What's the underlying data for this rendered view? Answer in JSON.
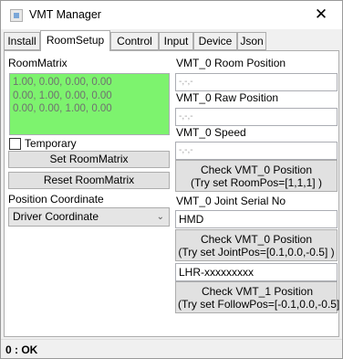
{
  "window": {
    "title": "VMT Manager",
    "close_glyph": "✕"
  },
  "tabs": [
    {
      "label": "Install"
    },
    {
      "label": "RoomSetup"
    },
    {
      "label": "Control"
    },
    {
      "label": "Input"
    },
    {
      "label": "Device"
    },
    {
      "label": "Json"
    }
  ],
  "room_matrix": {
    "label": "RoomMatrix",
    "rows": [
      "1.00, 0.00, 0.00, 0.00",
      "0.00, 1.00, 0.00, 0.00",
      "0.00, 0.00, 1.00, 0.00"
    ],
    "background": "#7df36e",
    "temporary_label": "Temporary",
    "temporary_checked": false,
    "set_button": "Set RoomMatrix",
    "reset_button": "Reset RoomMatrix"
  },
  "position_coordinate": {
    "label": "Position Coordinate",
    "selected": "Driver Coordinate"
  },
  "vmt0": {
    "room_position_label": "VMT_0 Room Position",
    "room_position_value": "-,-,-",
    "raw_position_label": "VMT_0 Raw Position",
    "raw_position_value": "-,-,-",
    "speed_label": "VMT_0 Speed",
    "speed_value": "-,-,-",
    "check_room_button": [
      "Check VMT_0 Position",
      "(Try set RoomPos=[1,1,1] )"
    ],
    "joint_serial_label": "VMT_0 Joint Serial No",
    "joint_serial_value": "HMD",
    "check_joint_button": [
      "Check VMT_0 Position",
      "(Try set JointPos=[0.1,0.0,-0.5] )"
    ]
  },
  "vmt1": {
    "follow_serial_value": "LHR-xxxxxxxxx",
    "check_follow_button": [
      "Check VMT_1 Position",
      "(Try set FollowPos=[-0.1,0.0,-0.5]"
    ]
  },
  "status": {
    "text": "0 : OK"
  }
}
